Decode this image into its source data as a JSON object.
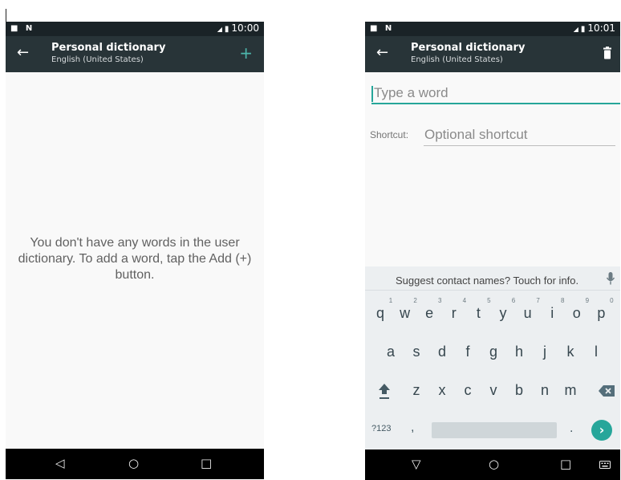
{
  "screen1": {
    "status": {
      "left_icons": "■ N",
      "time": "10:00"
    },
    "appbar": {
      "title": "Personal dictionary",
      "subtitle": "English (United States)",
      "add_label": "+"
    },
    "empty_message": "You don't have any words in the user dictionary. To add a word, tap the Add (+) button.",
    "nav": {
      "back": "◁",
      "home": "○",
      "recents": "□"
    }
  },
  "screen2": {
    "status": {
      "left_icons": "■ N",
      "time": "10:01"
    },
    "appbar": {
      "title": "Personal dictionary",
      "subtitle": "English (United States)"
    },
    "word_input": {
      "placeholder": "Type a word"
    },
    "shortcut": {
      "label": "Shortcut:",
      "placeholder": "Optional shortcut"
    },
    "keyboard": {
      "suggestion": "Suggest contact names? Touch for info.",
      "row1": [
        {
          "k": "q",
          "h": "1"
        },
        {
          "k": "w",
          "h": "2"
        },
        {
          "k": "e",
          "h": "3"
        },
        {
          "k": "r",
          "h": "4"
        },
        {
          "k": "t",
          "h": "5"
        },
        {
          "k": "y",
          "h": "6"
        },
        {
          "k": "u",
          "h": "7"
        },
        {
          "k": "i",
          "h": "8"
        },
        {
          "k": "o",
          "h": "9"
        },
        {
          "k": "p",
          "h": "0"
        }
      ],
      "row2": [
        "a",
        "s",
        "d",
        "f",
        "g",
        "h",
        "j",
        "k",
        "l"
      ],
      "row3": [
        "z",
        "x",
        "c",
        "v",
        "b",
        "n",
        "m"
      ],
      "sym": "?123",
      "comma": ",",
      "period": ".",
      "enter": "›"
    },
    "nav": {
      "back": "▽",
      "home": "○",
      "recents": "□"
    }
  },
  "colors": {
    "appbar": "#283438",
    "statusbar": "#1a2327",
    "accent": "#26a69a"
  }
}
